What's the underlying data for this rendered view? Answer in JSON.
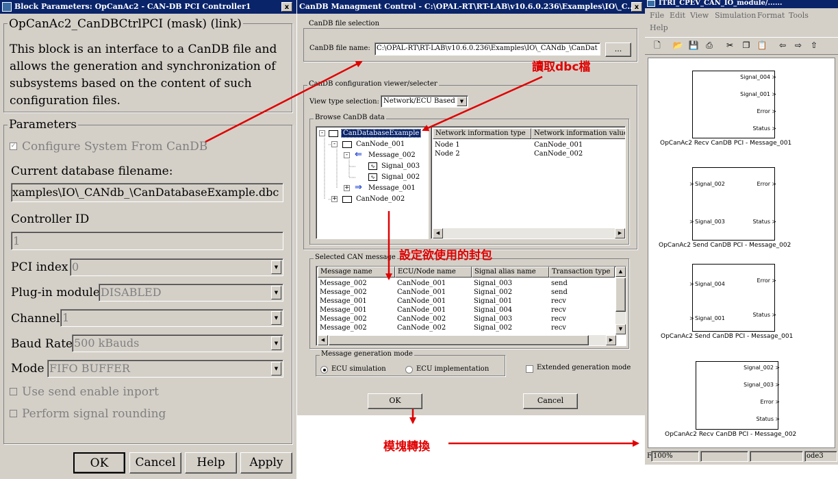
{
  "left": {
    "title": "Block Parameters: OpCanAc2 - CAN-DB PCI Controller1",
    "close": "x",
    "mask_title": "OpCanAc2_CanDBCtrlPCI (mask) (link)",
    "description": [
      "This block is an interface to a CanDB file and",
      "allows the generation and synchronization of",
      "subsystems based on the content of such",
      "configuration files."
    ],
    "parameters_label": "Parameters",
    "configure_label": "Configure System From CanDB",
    "current_db_label": "Current database filename:",
    "current_db_value": "xamples\\IO\\_CANdb_\\CanDatabaseExample.dbc",
    "controller_id_label": "Controller ID",
    "controller_id_value": "1",
    "pci_index_label": "PCI index",
    "pci_index_value": "0",
    "plugin_label": "Plug-in module",
    "plugin_value": "DISABLED",
    "channel_label": "Channel",
    "channel_value": "1",
    "baud_label": "Baud Rate",
    "baud_value": "500 kBauds",
    "mode_label": "Mode",
    "mode_value": "FIFO BUFFER",
    "use_send_label": "Use send enable inport",
    "perform_label": "Perform signal rounding",
    "buttons": {
      "ok": "OK",
      "cancel": "Cancel",
      "help": "Help",
      "apply": "Apply"
    }
  },
  "middle": {
    "title": "CanDB Managment Control - C:\\OPAL-RT\\RT-LAB\\v10.6.0.236\\Examples\\IO\\_C...",
    "close": "x",
    "file_group": "CanDB file selection",
    "file_label": "CanDB file name:",
    "file_value": "C:\\OPAL-RT\\RT-LAB\\v10.6.0.236\\Examples\\IO\\_CANdb_\\CanDat",
    "browse_btn": "...",
    "config_group": "CanDB configuration viewer/selecter",
    "view_type_label": "View type selection:",
    "view_type_value": "Network/ECU Based",
    "browse_group": "Browse CanDB data",
    "tree": {
      "root": "CanDatabaseExample",
      "node1": "CanNode_001",
      "msg002": "Message_002",
      "sig003": "Signal_003",
      "sig002": "Signal_002",
      "msg001": "Message_001",
      "node2": "CanNode_002"
    },
    "info_headers": [
      "Network information type",
      "Network information value"
    ],
    "info_rows": [
      [
        "Node 1",
        "CanNode_001"
      ],
      [
        "Node 2",
        "CanNode_002"
      ]
    ],
    "selected_group": "Selected CAN message",
    "msg_headers": [
      "Message name",
      "ECU/Node name",
      "Signal alias name",
      "Transaction type"
    ],
    "msg_rows": [
      [
        "Message_002",
        "CanNode_001",
        "Signal_003",
        "send"
      ],
      [
        "Message_002",
        "CanNode_001",
        "Signal_002",
        "send"
      ],
      [
        "Message_001",
        "CanNode_001",
        "Signal_001",
        "recv"
      ],
      [
        "Message_001",
        "CanNode_001",
        "Signal_004",
        "recv"
      ],
      [
        "Message_002",
        "CanNode_002",
        "Signal_003",
        "recv"
      ],
      [
        "Message_002",
        "CanNode_002",
        "Signal_002",
        "recv"
      ]
    ],
    "gen_mode_group": "Message generation mode",
    "ecu_sim": "ECU simulation",
    "ecu_impl": "ECU implementation",
    "extended": "Extended generation mode",
    "ok": "OK",
    "cancel": "Cancel"
  },
  "right": {
    "title": "ITRI_CPEV_CAN_IO_module/......",
    "menu": [
      "File",
      "Edit",
      "View",
      "Simulation",
      "Format",
      "Tools",
      "Help"
    ],
    "toolbar_icons": [
      "new-icon",
      "open-icon",
      "save-icon",
      "print-icon",
      "cut-icon",
      "copy-icon",
      "paste-icon",
      "back-icon",
      "forward-icon",
      "up-icon"
    ],
    "blocks": [
      {
        "outputs": [
          "Signal_004",
          "Signal_001",
          "Error",
          "Status"
        ],
        "inputs": [],
        "caption": "OpCanAc2 Recv CanDB PCI - Message_001"
      },
      {
        "outputs": [
          "Error",
          "Status"
        ],
        "inputs": [
          "Signal_002",
          "Signal_003"
        ],
        "caption": "OpCanAc2 Send CanDB PCI - Message_002"
      },
      {
        "outputs": [
          "Error",
          "Status"
        ],
        "inputs": [
          "Signal_004",
          "Signal_001"
        ],
        "caption": "OpCanAc2 Send CanDB PCI - Message_001"
      },
      {
        "outputs": [
          "Signal_002",
          "Signal_003",
          "Error",
          "Status"
        ],
        "inputs": [],
        "caption": "OpCanAc2 Recv CanDB PCI - Message_002"
      }
    ],
    "status_zoom": "100%",
    "status_mode": "ode3",
    "status_left": "F"
  },
  "annotations": {
    "read_dbc": "讀取dbc檔",
    "set_packet": "設定欲使用的封包",
    "block_convert": "模塊轉換"
  },
  "colors": {
    "arrow": "#e00000",
    "title": "#0a246a",
    "selection": "#0a246a"
  }
}
